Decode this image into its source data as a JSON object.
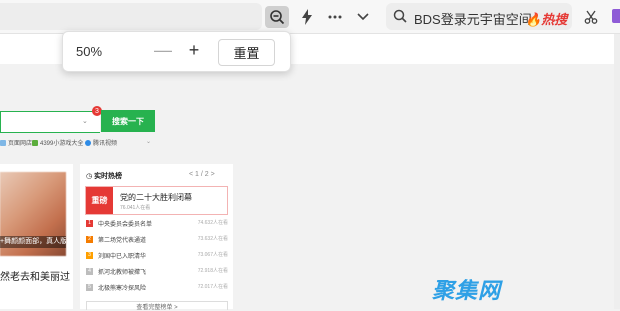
{
  "toolbar": {
    "search_query": "BDS登录元宇宙空间",
    "hot_label": "热搜"
  },
  "zoom_popup": {
    "percent": "50%",
    "minus": "—",
    "plus": "+",
    "reset_label": "重置"
  },
  "search": {
    "button_label": "搜索一下",
    "badge": "3"
  },
  "quick_links": [
    {
      "label": "页面网店"
    },
    {
      "label": "4399小游戏大全"
    },
    {
      "label": "腾讯视频"
    }
  ],
  "left_card": {
    "caption": "+舞颜颜面部，真人版小",
    "title": "然老去和美丽过"
  },
  "hot_panel": {
    "title": "实时热榜",
    "pager": "< 1 / 2 >",
    "feature": {
      "tag": "重磅",
      "title": "党的二十大胜利闭幕",
      "views": "76.041人在看"
    },
    "items": [
      {
        "num": "1",
        "title": "中央委员会委员名单",
        "count": "74.632人在看",
        "color": "#e53935"
      },
      {
        "num": "2",
        "title": "第二场党代表通道",
        "count": "73.632人在看",
        "color": "#f57c00"
      },
      {
        "num": "3",
        "title": "刘国中已入职清华",
        "count": "73.067人在看",
        "color": "#ffa000"
      },
      {
        "num": "4",
        "title": "抓河北教师被撵飞",
        "count": "72.918人在看",
        "color": "#bdbdbd"
      },
      {
        "num": "5",
        "title": "北极熊寒冷探风险",
        "count": "72.017人在看",
        "color": "#bdbdbd"
      }
    ],
    "more_label": "查看完整榜单 >"
  },
  "watermark": "聚集网",
  "colors": {
    "accent_green": "#27b24f",
    "hot_red": "#e53935",
    "watermark_blue": "#2ea0e6"
  }
}
